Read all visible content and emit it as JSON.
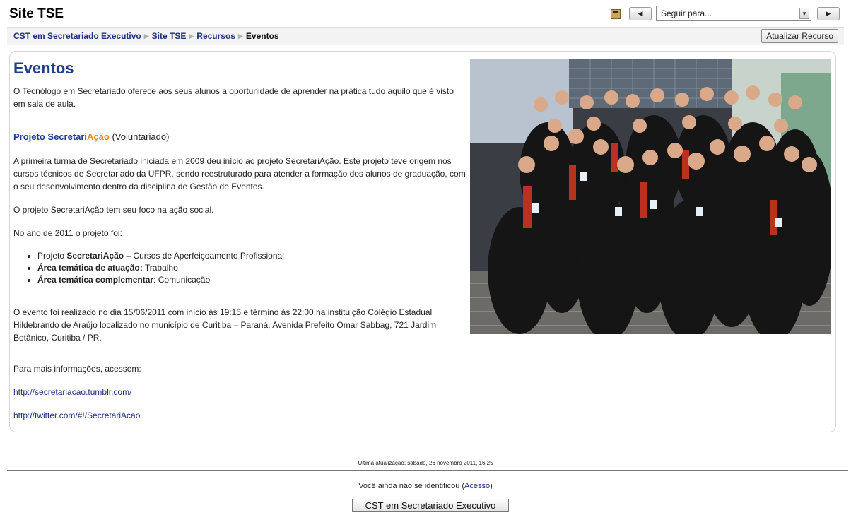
{
  "header": {
    "site_title": "Site TSE",
    "jump_placeholder": "Seguir para...",
    "prev_icon": "triangle-left",
    "next_icon": "triangle-right"
  },
  "navbar": {
    "crumbs": [
      "CST em Secretariado Executivo",
      "Site TSE",
      "Recursos"
    ],
    "current": "Eventos",
    "update_button": "Atualizar Recurso"
  },
  "content": {
    "title": "Eventos",
    "intro": "O Tecnólogo em Secretariado oferece aos seus alunos a oportunidade de aprender na prática tudo aquilo que é visto em sala de aula.",
    "project": {
      "title_part1": "Projeto Secretari",
      "title_part2": "Ação",
      "title_part3": " (Voluntariado)"
    },
    "para1": "A primeira turma de Secretariado iniciada em 2009 deu início ao projeto SecretariAção. Este projeto teve origem nos cursos técnicos de Secretariado da UFPR, sendo reestruturado para atender a formação dos alunos de graduação, com o seu desenvolvimento dentro da disciplina de Gestão de Eventos.",
    "para2": "O projeto SecretariAção tem seu foco na ação social.",
    "para3": "No ano de 2011 o projeto foi:",
    "bullets": [
      {
        "prefix": "Projeto ",
        "bold": "SecretariAção",
        "rest": " – Cursos de Aperfeiçoamento Profissional"
      },
      {
        "prefix": "",
        "bold": "Área temática de atuação:",
        "rest": " Trabalho"
      },
      {
        "prefix": "",
        "bold": "Área temática complementar",
        "rest": ": Comunicação"
      }
    ],
    "para4": "O evento foi realizado no dia 15/06/2011 com início às 19:15 e término às 22:00 na instituição Colégio Estadual Hildebrando de Araújo localizado no município de Curitiba – Paraná, Avenida Prefeito Omar Sabbag, 721 Jardim Botânico, Curitiba / PR.",
    "para5": "Para mais informações, acessem:",
    "link1": "http://secretariacao.tumblr.com/",
    "link2": "http://twitter.com/#!/SecretariAcao"
  },
  "footer": {
    "last_update": "Última atualização: sábado, 26 novembro 2011, 16:25",
    "login_text": "Você ainda não se identificou (",
    "login_link": "Acesso",
    "login_close": ")",
    "home_button": "CST em Secretariado Executivo"
  },
  "colors": {
    "link": "#1f2f7a",
    "title": "#1f3f8a",
    "accent_orange": "#e2882a"
  }
}
